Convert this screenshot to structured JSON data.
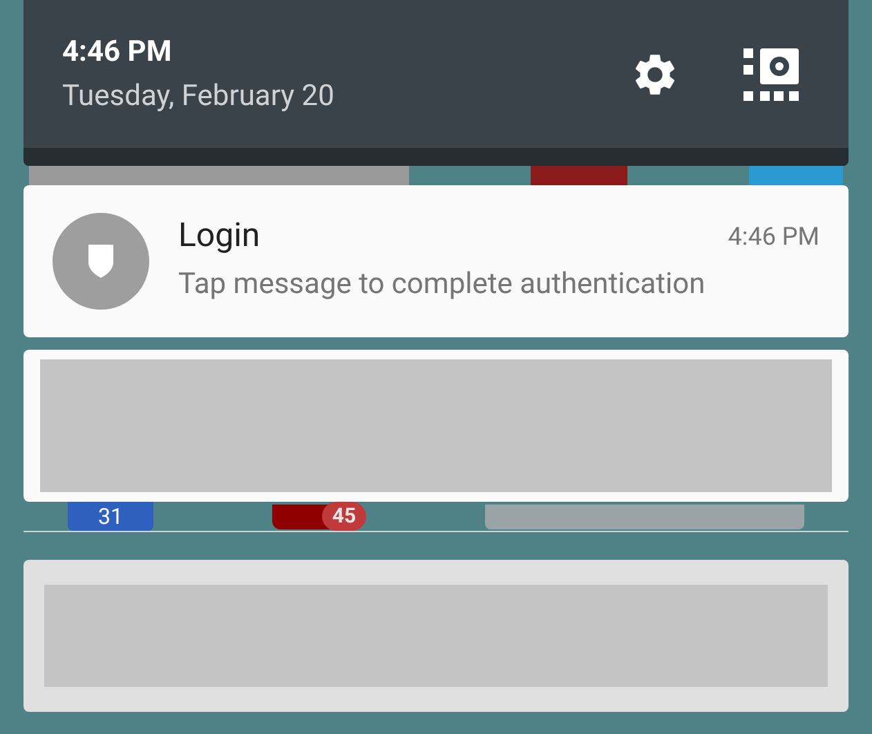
{
  "header": {
    "time": "4:46 PM",
    "date": "Tuesday, February 20"
  },
  "notifications": [
    {
      "kind": "message",
      "title": "Login",
      "time": "4:46 PM",
      "text": "Tap message to complete authentication",
      "muted": false
    },
    {
      "kind": "redacted",
      "muted": false
    }
  ],
  "home_screen": {
    "calendar_date": "31",
    "badge_count": "45"
  },
  "silent_notifications": [
    {
      "kind": "redacted",
      "muted": true
    }
  ]
}
